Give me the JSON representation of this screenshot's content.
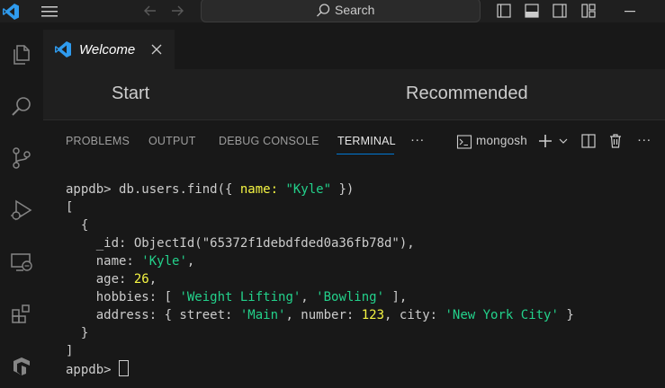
{
  "titlebar": {
    "search_label": "Search"
  },
  "tab": {
    "label": "Welcome"
  },
  "welcome": {
    "start": "Start",
    "recommended": "Recommended"
  },
  "panel": {
    "tabs": [
      "PROBLEMS",
      "OUTPUT",
      "DEBUG CONSOLE",
      "TERMINAL"
    ],
    "terminal_name": "mongosh",
    "more": "···"
  },
  "terminal": {
    "prompt": "appdb> ",
    "command_pre": "db.users.find({ ",
    "command_key": "name: ",
    "command_val": "\"Kyle\"",
    "command_post": " })",
    "open_bracket": "[",
    "open_brace": "  {",
    "id_line": "    _id: ObjectId(\"65372f1debdfded0a36fb78d\"),",
    "name_key": "    name: ",
    "name_val": "'Kyle'",
    "age_key": "    age: ",
    "age_val": "26",
    "hobbies_key": "    hobbies: [ ",
    "hobby1": "'Weight Lifting'",
    "hobby2": "'Bowling'",
    "hobbies_end": " ],",
    "address_key": "    address: { street: ",
    "street_val": "'Main'",
    "number_key": ", number: ",
    "number_val": "123",
    "city_key": ", city: ",
    "city_val": "'New York City'",
    "address_end": " }",
    "close_brace": "  }",
    "close_bracket": "]",
    "prompt2": "appdb> "
  },
  "colors": {
    "accent": "#0078d4",
    "string": "#23d18b",
    "number": "#f5f543"
  }
}
